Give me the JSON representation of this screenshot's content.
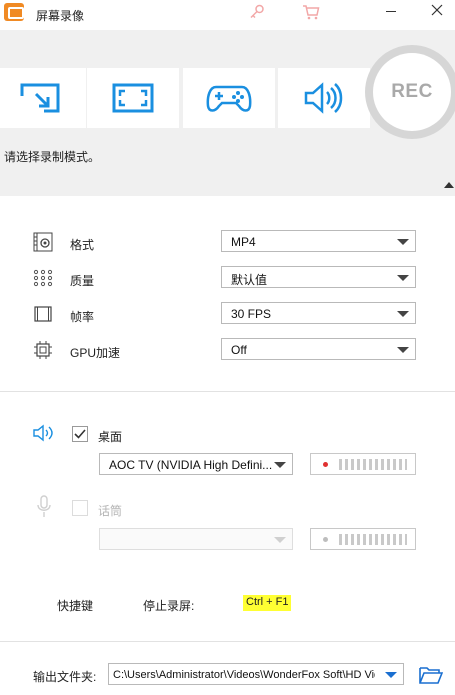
{
  "app": {
    "title": "屏幕录像"
  },
  "mode": {
    "buttons": [
      {
        "name": "region-capture",
        "icon": "region-arrow-icon"
      },
      {
        "name": "fullscreen-capture",
        "icon": "fullscreen-icon"
      },
      {
        "name": "game-capture",
        "icon": "gamepad-icon"
      },
      {
        "name": "audio-only",
        "icon": "speaker-icon"
      }
    ],
    "rec_label": "REC",
    "hint": "请选择录制模式。"
  },
  "settings": {
    "format": {
      "label": "格式",
      "value": "MP4"
    },
    "quality": {
      "label": "质量",
      "value": "默认值"
    },
    "framerate": {
      "label": "帧率",
      "value": "30 FPS"
    },
    "gpu": {
      "label": "GPU加速",
      "value": "Off"
    }
  },
  "audio": {
    "desktop": {
      "label": "桌面",
      "checked": true,
      "device": "AOC TV (NVIDIA High Defini..."
    },
    "mic": {
      "label": "话筒",
      "checked": false,
      "device": ""
    }
  },
  "shortcut": {
    "title": "快捷键",
    "stop_label": "停止录屏:",
    "stop_key": "Ctrl + F1"
  },
  "output": {
    "label": "输出文件夹:",
    "path": "C:\\Users\\Administrator\\Videos\\WonderFox Soft\\HD Video Converter Factory Pro"
  },
  "colors": {
    "accent": "#1a8fe0",
    "rec_ring": "#d6d6d6",
    "hotkey_bg": "#ffff33",
    "rec_dot": "#e03030"
  }
}
